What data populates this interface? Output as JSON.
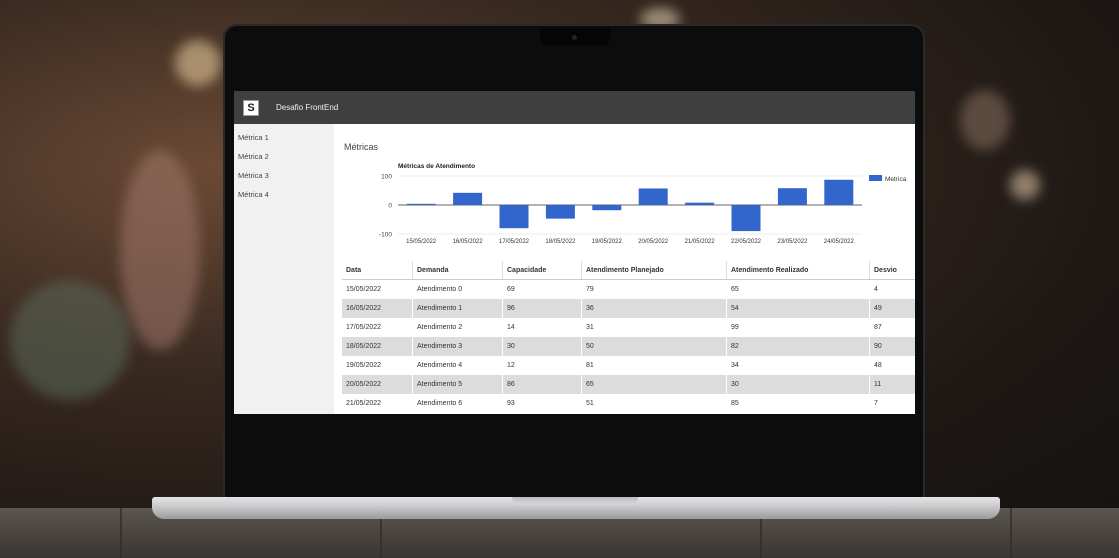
{
  "app": {
    "logo_letter": "S",
    "title": "Desafio FrontEnd"
  },
  "sidebar": {
    "items": [
      {
        "label": "Métrica 1"
      },
      {
        "label": "Métrica 2"
      },
      {
        "label": "Métrica 3"
      },
      {
        "label": "Métrica 4"
      }
    ]
  },
  "page": {
    "title": "Métricas"
  },
  "colors": {
    "topbar": "#3f3f3f",
    "bar": "#3366cc",
    "sidebar": "#f1f1f1",
    "row_alt": "#dcdcdc"
  },
  "chart_data": {
    "type": "bar",
    "title": "Métricas de Atendimento",
    "categories": [
      "15/05/2022",
      "16/05/2022",
      "17/05/2022",
      "18/05/2022",
      "19/05/2022",
      "20/05/2022",
      "21/05/2022",
      "22/05/2022",
      "23/05/2022",
      "24/05/2022"
    ],
    "series": [
      {
        "name": "Metrica",
        "values": [
          4,
          42,
          -80,
          -47,
          -18,
          57,
          8,
          -90,
          58,
          87
        ]
      }
    ],
    "yticks": [
      "100",
      "0",
      "-100"
    ],
    "ylim": [
      -100,
      100
    ],
    "legend": "right",
    "grid": true
  },
  "table": {
    "headers": [
      "Data",
      "Demanda",
      "Capacidade",
      "Atendimento Planejado",
      "Atendimento Realizado",
      "Desvio"
    ],
    "rows": [
      [
        "15/05/2022",
        "Atendimento 0",
        "69",
        "79",
        "65",
        "4"
      ],
      [
        "16/05/2022",
        "Atendimento 1",
        "96",
        "36",
        "54",
        "49"
      ],
      [
        "17/05/2022",
        "Atendimento 2",
        "14",
        "31",
        "99",
        "87"
      ],
      [
        "18/05/2022",
        "Atendimento 3",
        "30",
        "50",
        "82",
        "90"
      ],
      [
        "19/05/2022",
        "Atendimento 4",
        "12",
        "81",
        "34",
        "48"
      ],
      [
        "20/05/2022",
        "Atendimento 5",
        "86",
        "65",
        "30",
        "11"
      ],
      [
        "21/05/2022",
        "Atendimento 6",
        "93",
        "51",
        "85",
        "7"
      ]
    ]
  }
}
